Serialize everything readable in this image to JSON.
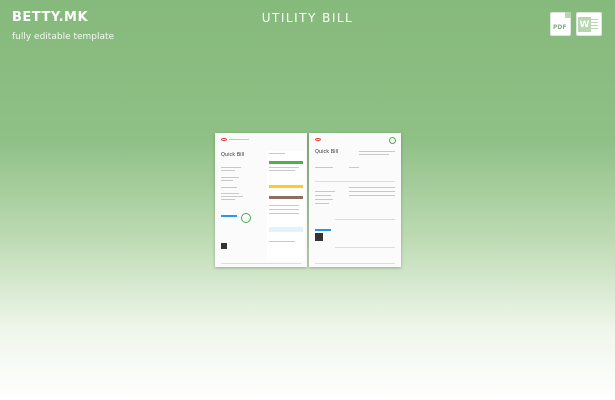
{
  "brand": {
    "name": "BETTY.MK",
    "tagline": "fully editable template"
  },
  "page": {
    "title": "UTILITY BILL"
  },
  "downloads": {
    "pdf_label": "PDF",
    "word_label": "W"
  },
  "colors": {
    "background_top": "#86b97c",
    "accent_green": "#4caf50",
    "accent_blue": "#2196f3",
    "accent_brown": "#8d6e63"
  },
  "preview": {
    "left_page": {
      "heading": "Quick Bill"
    },
    "right_page": {
      "heading": "Quick Bill"
    }
  }
}
